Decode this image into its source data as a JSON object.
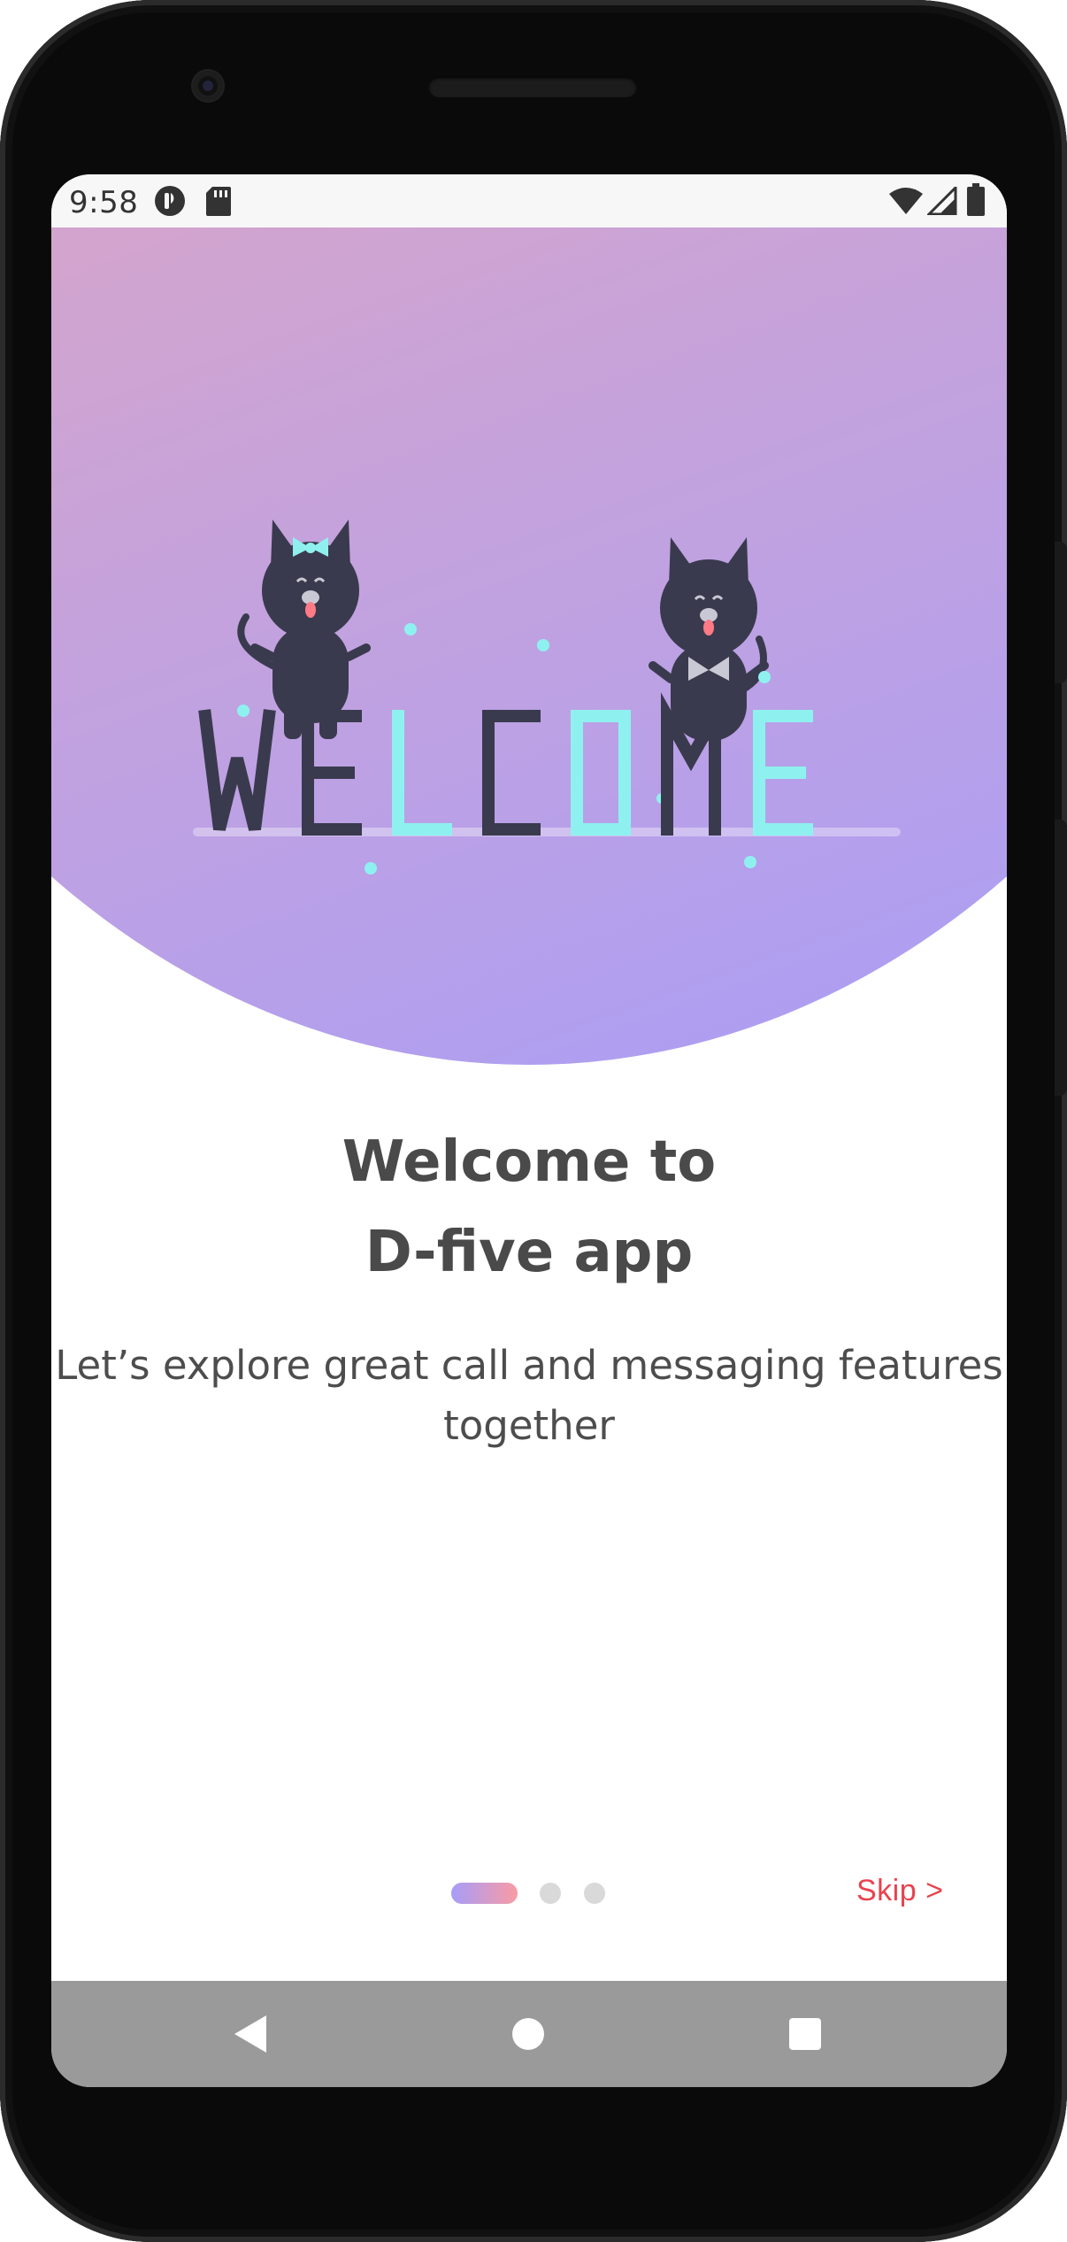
{
  "status_bar": {
    "time": "9:58",
    "left_icons": [
      "assistant-icon",
      "sd-card-icon"
    ],
    "right_icons": [
      "wifi-icon",
      "signal-icon",
      "battery-icon"
    ]
  },
  "hero": {
    "illustration_text": "WELCOME",
    "gradient": [
      "#f8a8a0",
      "#a69df9"
    ]
  },
  "onboarding": {
    "title_line1": "Welcome to",
    "title_line2": "D-five app",
    "subtitle_line1": "Let’s explore great call and messaging features",
    "subtitle_line2": "together"
  },
  "pager": {
    "page_count": 3,
    "active_index": 0
  },
  "actions": {
    "skip_label": "Skip >"
  },
  "nav": {
    "icons": [
      "back-icon",
      "home-icon",
      "recents-icon"
    ]
  },
  "colors": {
    "accent": "#e8434f",
    "text": "#4a4a4a",
    "nav_bar": "#9a9a9a"
  }
}
